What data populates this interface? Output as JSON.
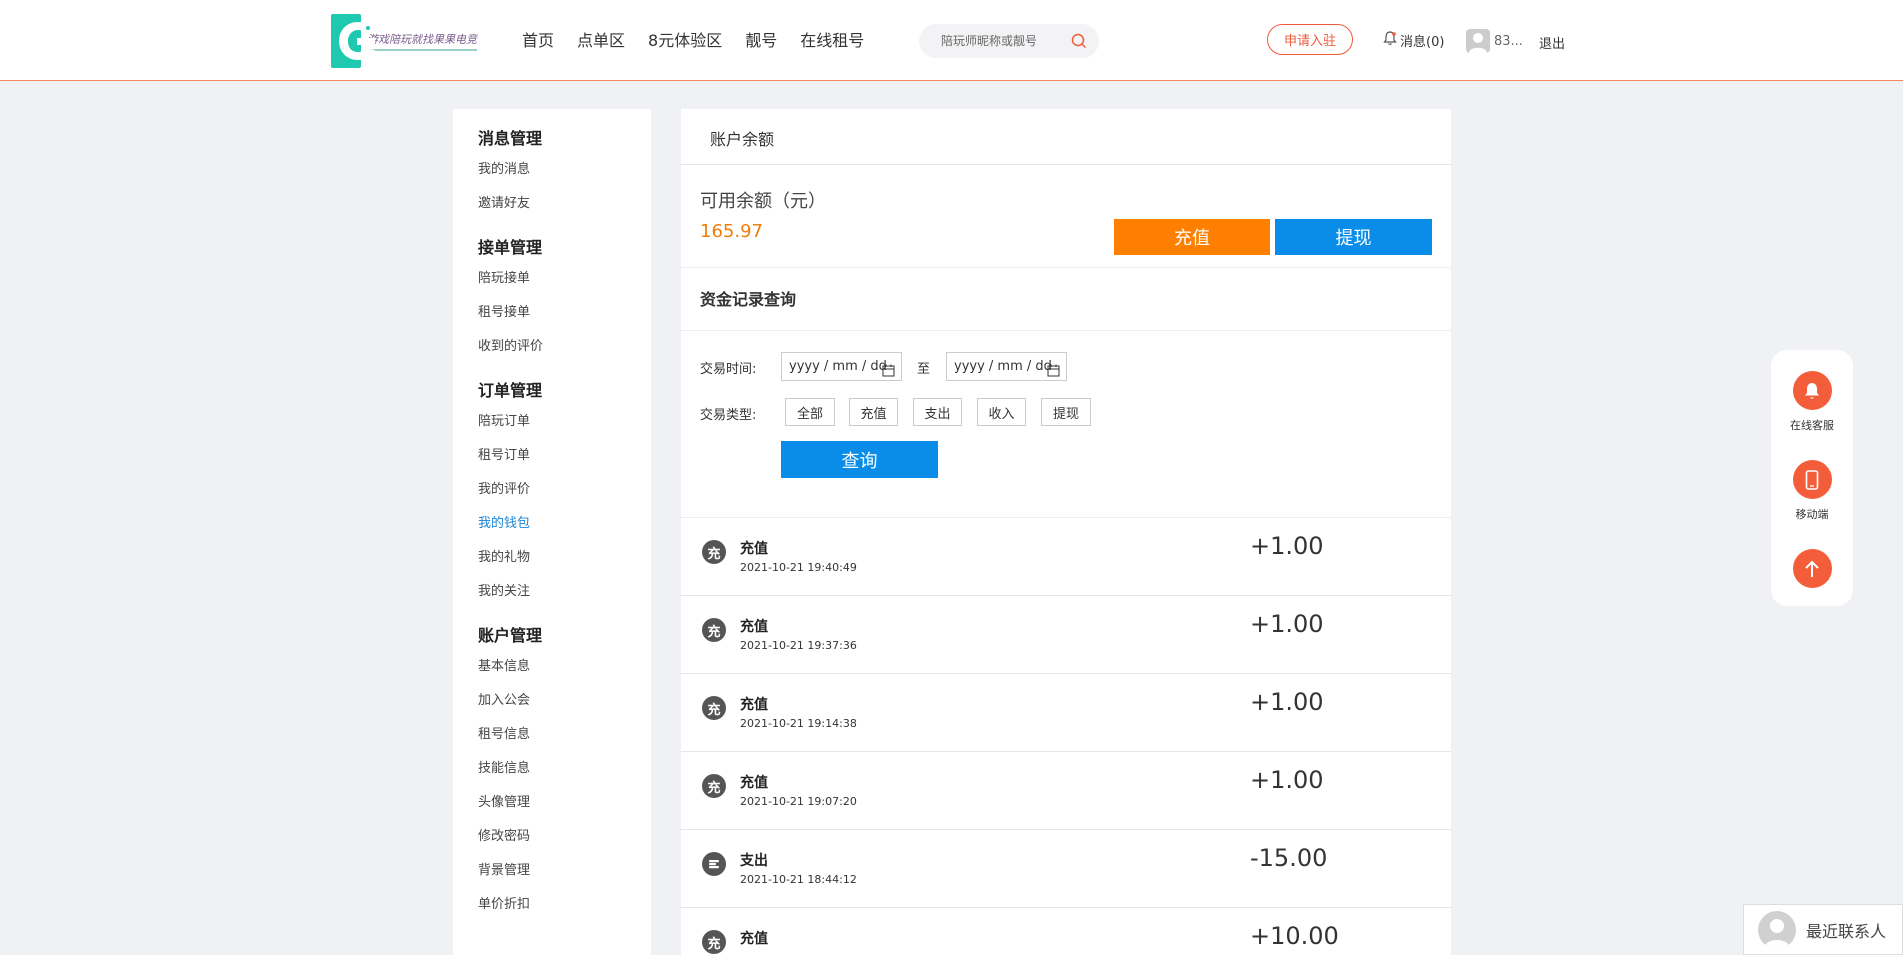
{
  "header": {
    "logo_text": "游戏陪玩就找果果电竞",
    "nav": [
      "首页",
      "点单区",
      "8元体验区",
      "靓号",
      "在线租号"
    ],
    "search_placeholder": "陪玩师昵称或靓号",
    "apply_label": "申请入驻",
    "message_label": "消息(0)",
    "username": "83...",
    "logout_label": "退出"
  },
  "sidebar": {
    "groups": [
      {
        "title": "消息管理",
        "items": [
          "我的消息",
          "邀请好友"
        ]
      },
      {
        "title": "接单管理",
        "items": [
          "陪玩接单",
          "租号接单",
          "收到的评价"
        ]
      },
      {
        "title": "订单管理",
        "items": [
          "陪玩订单",
          "租号订单",
          "我的评价",
          "我的钱包",
          "我的礼物",
          "我的关注"
        ]
      },
      {
        "title": "账户管理",
        "items": [
          "基本信息",
          "加入公会",
          "租号信息",
          "技能信息",
          "头像管理",
          "修改密码",
          "背景管理",
          "单价折扣"
        ]
      }
    ],
    "active_item": "我的钱包"
  },
  "main": {
    "title": "账户余额",
    "balance_label": "可用余额（元）",
    "balance_value": "165.97",
    "recharge_label": "充值",
    "withdraw_label": "提现",
    "query_title": "资金记录查询",
    "time_label": "交易时间:",
    "date_placeholder": "yyyy / mm / dd",
    "to_label": "至",
    "type_label": "交易类型:",
    "types": [
      "全部",
      "充值",
      "支出",
      "收入",
      "提现"
    ],
    "query_label": "查询",
    "records": [
      {
        "icon": "充",
        "type": "充值",
        "time": "2021-10-21 19:40:49",
        "amount": "+1.00"
      },
      {
        "icon": "充",
        "type": "充值",
        "time": "2021-10-21 19:37:36",
        "amount": "+1.00"
      },
      {
        "icon": "充",
        "type": "充值",
        "time": "2021-10-21 19:14:38",
        "amount": "+1.00"
      },
      {
        "icon": "充",
        "type": "充值",
        "time": "2021-10-21 19:07:20",
        "amount": "+1.00"
      },
      {
        "icon": "coin-stack-icon",
        "type": "支出",
        "time": "2021-10-21 18:44:12",
        "amount": "-15.00"
      },
      {
        "icon": "充",
        "type": "充值",
        "time": "",
        "amount": "+10.00"
      }
    ]
  },
  "float_panel": {
    "service_label": "在线客服",
    "mobile_label": "移动端"
  },
  "contacts": {
    "label": "最近联系人"
  },
  "colors": {
    "accent_orange": "#ff7f00",
    "accent_blue": "#0a8de8",
    "brand_red": "#f35d3a",
    "active_link": "#1a86d9"
  }
}
